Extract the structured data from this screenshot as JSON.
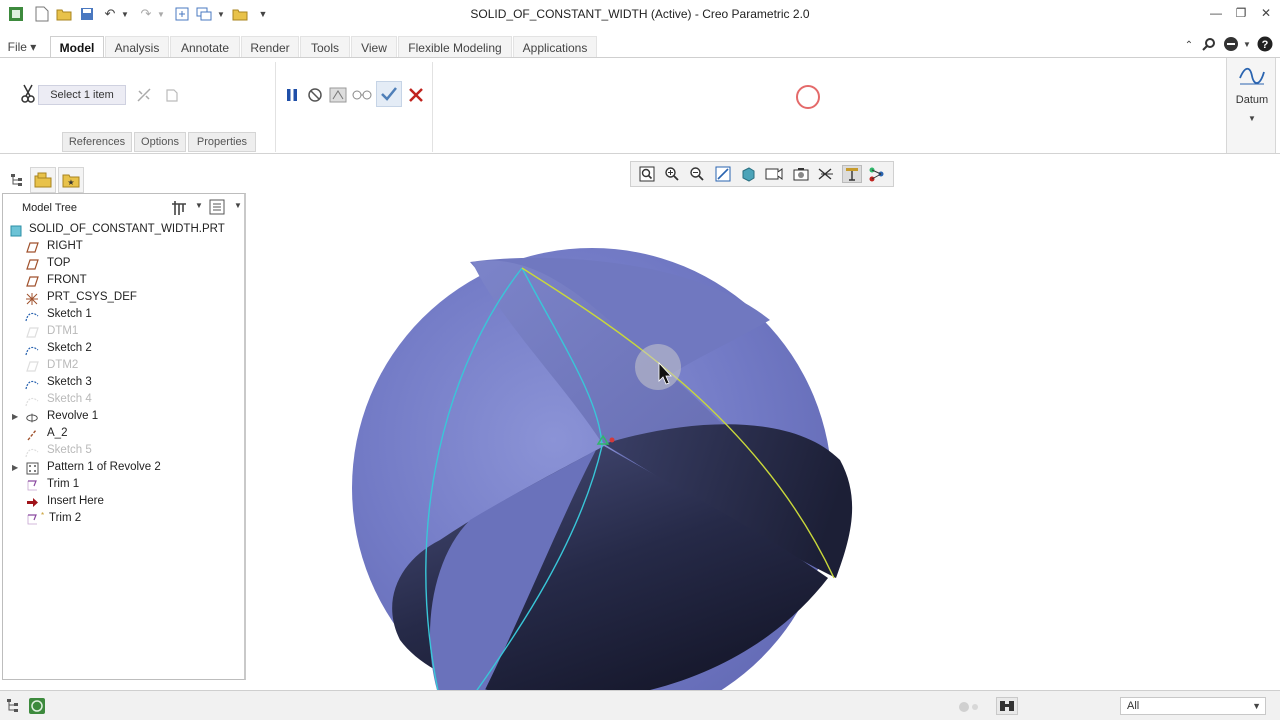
{
  "window": {
    "title": "SOLID_OF_CONSTANT_WIDTH (Active) - Creo Parametric 2.0"
  },
  "tabs": [
    {
      "label": "File ▾",
      "active": false
    },
    {
      "label": "Model",
      "active": true
    },
    {
      "label": "Analysis",
      "active": false
    },
    {
      "label": "Annotate",
      "active": false
    },
    {
      "label": "Render",
      "active": false
    },
    {
      "label": "Tools",
      "active": false
    },
    {
      "label": "View",
      "active": false
    },
    {
      "label": "Flexible Modeling",
      "active": false
    },
    {
      "label": "Applications",
      "active": false
    }
  ],
  "dashboard": {
    "select_label": "Select 1 item",
    "slide_tabs": [
      "References",
      "Options",
      "Properties"
    ]
  },
  "datum": {
    "label": "Datum"
  },
  "model_tree": {
    "title": "Model Tree",
    "root": "SOLID_OF_CONSTANT_WIDTH.PRT",
    "items": [
      {
        "label": "RIGHT",
        "icon": "datum-plane-icon",
        "dim": false,
        "expandable": false
      },
      {
        "label": "TOP",
        "icon": "datum-plane-icon",
        "dim": false,
        "expandable": false
      },
      {
        "label": "FRONT",
        "icon": "datum-plane-icon",
        "dim": false,
        "expandable": false
      },
      {
        "label": "PRT_CSYS_DEF",
        "icon": "csys-icon",
        "dim": false,
        "expandable": false
      },
      {
        "label": "Sketch 1",
        "icon": "sketch-icon",
        "dim": false,
        "expandable": false
      },
      {
        "label": "DTM1",
        "icon": "datum-plane-icon",
        "dim": true,
        "expandable": false
      },
      {
        "label": "Sketch 2",
        "icon": "sketch-icon",
        "dim": false,
        "expandable": false
      },
      {
        "label": "DTM2",
        "icon": "datum-plane-icon",
        "dim": true,
        "expandable": false
      },
      {
        "label": "Sketch 3",
        "icon": "sketch-icon",
        "dim": false,
        "expandable": false
      },
      {
        "label": "Sketch 4",
        "icon": "sketch-icon",
        "dim": true,
        "expandable": false
      },
      {
        "label": "Revolve 1",
        "icon": "revolve-icon",
        "dim": false,
        "expandable": true
      },
      {
        "label": "A_2",
        "icon": "axis-icon",
        "dim": false,
        "expandable": false
      },
      {
        "label": "Sketch 5",
        "icon": "sketch-icon",
        "dim": true,
        "expandable": false
      },
      {
        "label": "Pattern 1 of Revolve 2",
        "icon": "pattern-icon",
        "dim": false,
        "expandable": true
      },
      {
        "label": "Trim 1",
        "icon": "trim-icon",
        "dim": false,
        "expandable": false
      },
      {
        "label": "Insert Here",
        "icon": "insert-arrow-icon",
        "dim": false,
        "expandable": false
      },
      {
        "label": "Trim 2",
        "icon": "trim-icon",
        "dim": false,
        "expandable": false
      }
    ]
  },
  "status": {
    "filter_value": "All"
  }
}
